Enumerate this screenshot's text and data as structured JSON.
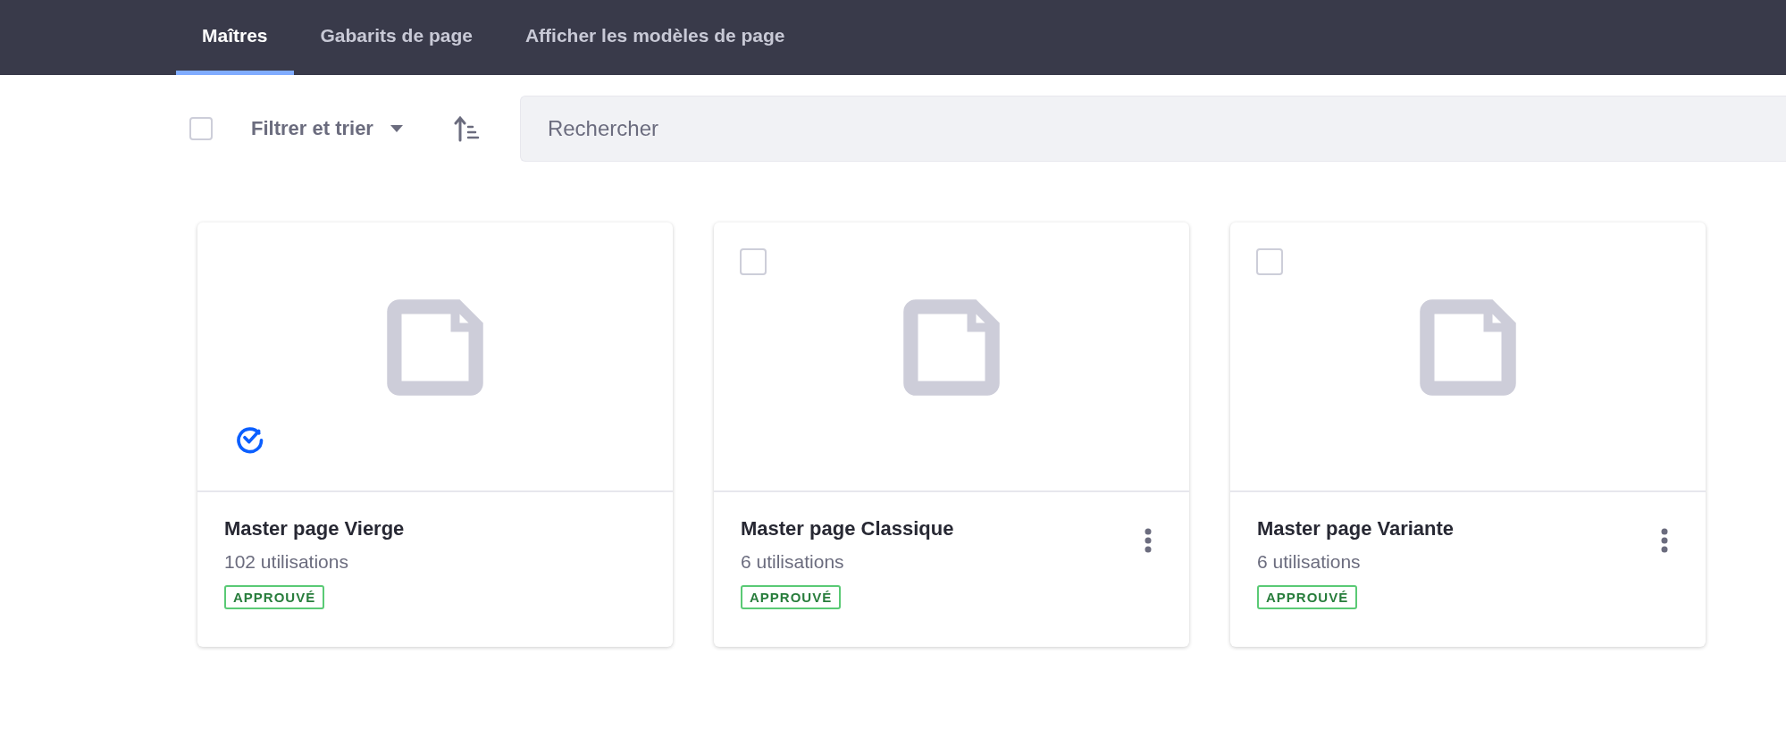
{
  "tabs": [
    {
      "label": "Maîtres",
      "selected": true
    },
    {
      "label": "Gabarits de page",
      "selected": false
    },
    {
      "label": "Afficher les modèles de page",
      "selected": false
    }
  ],
  "toolbar": {
    "select_all_checked": false,
    "filter_label": "Filtrer et trier",
    "search": {
      "placeholder": "Rechercher"
    }
  },
  "cards": [
    {
      "kind": "default",
      "title": "Master page Vierge",
      "usage": "102 utilisations",
      "status": "APPROUVÉ"
    },
    {
      "kind": "selectable",
      "checked": false,
      "title": "Master page Classique",
      "usage": "6 utilisations",
      "status": "APPROUVÉ"
    },
    {
      "kind": "selectable",
      "checked": false,
      "title": "Master page Variante",
      "usage": "6 utilisations",
      "status": "APPROUVÉ"
    }
  ]
}
